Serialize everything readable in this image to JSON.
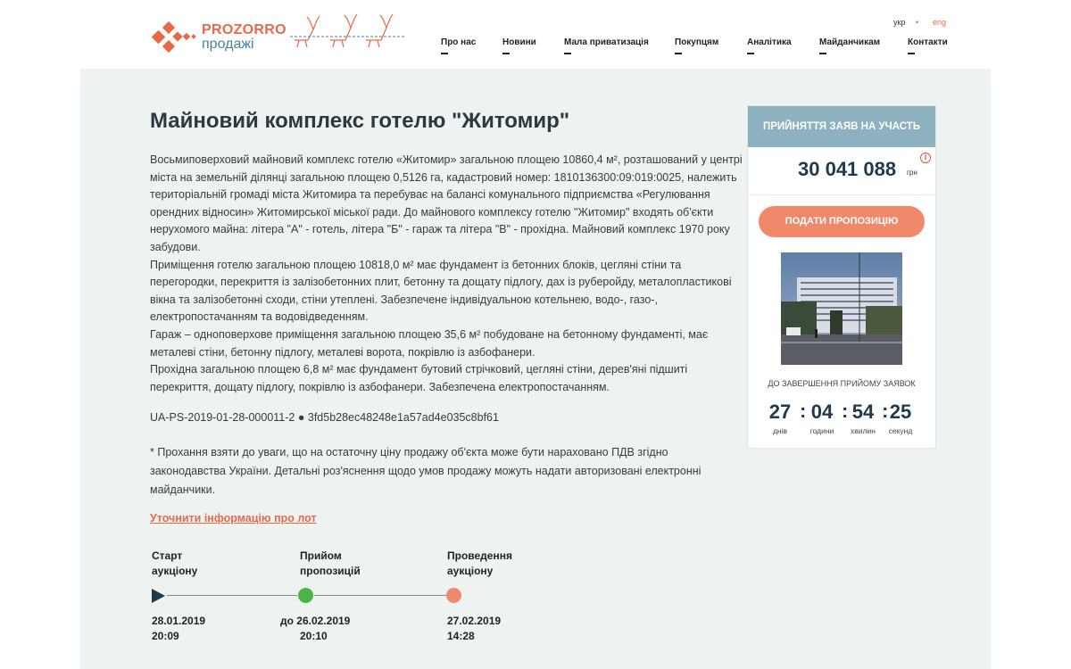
{
  "header": {
    "logo_line1": "PROZORRO",
    "logo_line2": "продажі",
    "lang_ukr": "укр",
    "lang_separator": "•",
    "lang_eng": "eng",
    "nav": [
      "Про нас",
      "Новини",
      "Мала приватизація",
      "Покупцям",
      "Аналітика",
      "Майданчикам",
      "Контакти"
    ]
  },
  "lot": {
    "title": "Майновий комплекс готелю \"Житомир\"",
    "description": [
      "Восьмиповерховий майновий комплекс готелю «Житомир» загальною площею 10860,4 м², розташований у центрі міста на земельній ділянці загальною площею 0,5126 га, кадастровий номер: 1810136300:09:019:0025, належить територіальній громаді міста Житомира та перебуває на балансі комунального підприємства «Регулювання орендних відносин» Житомирської міської ради. До майнового комплексу готелю \"Житомир\" входять об'єкти нерухомого майна: літера \"А\" - готель, літера \"Б\" - гараж та літера \"В\" - прохідна. Майновий комплекс 1970 року забудови.",
      "Приміщення готелю загальною площею 10818,0 м² має фундамент із бетонних блоків, цегляні стіни та перегородки, перекриття із залізобетонних плит, бетонну та дощату підлогу, дах із руберойду, металопластикові вікна та залізобетонні сходи, стіни утеплені. Забезпечене індивідуальною котельнею, водо-, газо-, електропостачанням та водовідведенням.",
      "Гараж – одноповерхове приміщення загальною площею 35,6 м² побудоване на бетонному фундаменті, має металеві стіни, бетонну підлогу, металеві ворота, покрівлю із азбофанери.",
      "Прохідна загальною площею 6,8 м² має фундамент бутовий стрічковий, цегляні стіни, дерев'яні підшиті перекриття, дощату підлогу, покрівлю із азбофанери. Забезпечена електропостачанням."
    ],
    "lot_id": "UA-PS-2019-01-28-000011-2 ● 3fd5b28ec48248e1a57ad4e035c8bf61",
    "vat_note": "* Прохання взяти до уваги, що на остаточну ціну продажу об'єкта може бути нараховано ПДВ згідно законодавства України. Детальні роз'яснення щодо умов продажу можуть надати авторизовані електронні майданчики.",
    "clarify_link": "Уточнити інформацію про лот"
  },
  "timeline": {
    "steps": [
      {
        "label_line1": "Старт",
        "label_line2": "аукціону",
        "date": "28.01.2019",
        "time": "20:09",
        "color": "#1f3a4d"
      },
      {
        "label_line1": "Прийом",
        "label_line2": "пропозицій",
        "date": "до 26.02.2019",
        "time": "20:10",
        "color": "#4bb543"
      },
      {
        "label_line1": "Проведення",
        "label_line2": "аукціону",
        "date": "27.02.2019",
        "time": "14:28",
        "color": "#f0886c"
      }
    ]
  },
  "sidebar": {
    "status": "ПРИЙНЯТТЯ ЗАЯВ НА УЧАСТЬ",
    "price": "30 041 088",
    "currency": "грн",
    "info_icon": "i",
    "bid_button": "ПОДАТИ ПРОПОЗИЦІЮ",
    "countdown_caption": "ДО ЗАВЕРШЕННЯ ПРИЙОМУ ЗАЯВОК",
    "countdown": {
      "days": "27",
      "hours": "04",
      "minutes": "54",
      "seconds": "25",
      "days_label": "днів",
      "hours_label": "години",
      "minutes_label": "хвилин",
      "seconds_label": "секунд"
    }
  },
  "colors": {
    "accent": "#e8694a",
    "brand_blue": "#4a7fa3",
    "status_header": "#8db1bf",
    "main_bg": "#eef3f1",
    "dark": "#1f3a4d"
  }
}
